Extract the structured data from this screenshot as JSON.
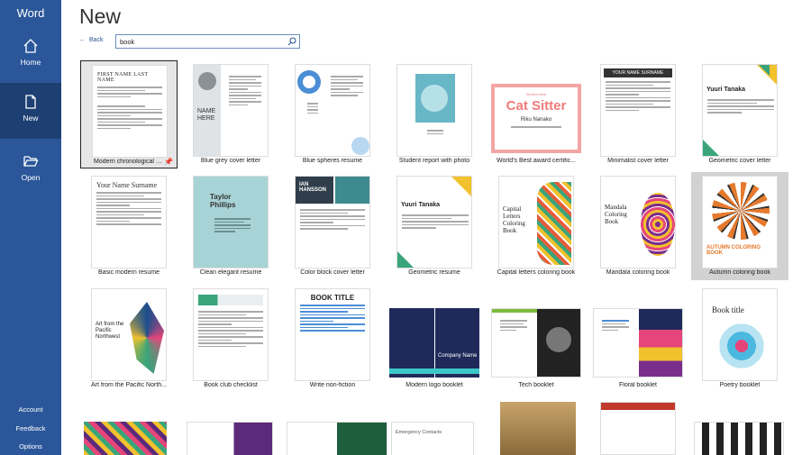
{
  "app": {
    "name": "Word"
  },
  "sidebar": {
    "items": [
      {
        "label": "Home",
        "icon": "home-icon"
      },
      {
        "label": "New",
        "icon": "new-document-icon"
      },
      {
        "label": "Open",
        "icon": "folder-icon"
      }
    ],
    "bottom": [
      {
        "label": "Account"
      },
      {
        "label": "Feedback"
      },
      {
        "label": "Options"
      }
    ]
  },
  "page": {
    "title": "New",
    "back_label": "Back"
  },
  "search": {
    "value": "book",
    "icon": "search-icon"
  },
  "templates": [
    {
      "caption": "Modern chronological cov..."
    },
    {
      "caption": "Blue grey cover letter"
    },
    {
      "caption": "Blue spheres resume"
    },
    {
      "caption": "Student report with photo"
    },
    {
      "caption": "World's Best award certific..."
    },
    {
      "caption": "Minimalist cover letter"
    },
    {
      "caption": "Geometric cover letter"
    },
    {
      "caption": "Basic modern resume"
    },
    {
      "caption": "Clean elegant resume"
    },
    {
      "caption": "Color block cover letter"
    },
    {
      "caption": "Geometric resume"
    },
    {
      "caption": "Capital letters coloring book"
    },
    {
      "caption": "Mandala coloring book"
    },
    {
      "caption": "Autumn coloring book"
    },
    {
      "caption": "Art from the Pacific North..."
    },
    {
      "caption": "Book club checklist"
    },
    {
      "caption": "Write non-fiction"
    },
    {
      "caption": "Modern logo booklet"
    },
    {
      "caption": "Tech booklet"
    },
    {
      "caption": "Floral booklet"
    },
    {
      "caption": "Poetry booklet"
    }
  ],
  "thumb_text": {
    "t0_name": "FIRST NAME LAST NAME",
    "t1_name": "NAME HERE",
    "t4_small": "World's Best",
    "t4_title": "Cat Sitter",
    "t4_name": "Riku Nanako",
    "t5_name": "YOUR NAME SURNAME",
    "t6_name": "Yuuri Tanaka",
    "t7_name": "Your Name Surname",
    "t8_name": "Taylor Phillips",
    "t9_name": "IAN HANSSON",
    "t10_name": "Yuuri Tanaka",
    "t11_title": "Capital Letters Coloring Book",
    "t12_title": "Mandala Coloring Book",
    "t13_title": "AUTUMN COLORING BOOK",
    "t14_title": "Art from the Pacific Northwest",
    "t16_title": "BOOK TITLE",
    "t17_company": "Company Name",
    "t20_title": "Book title",
    "p3_text": "Emergency Contacts"
  },
  "colors": {
    "sidebar": "#2b579a",
    "sidebar_active": "#1d3f72",
    "cat_sitter": "#f07a7a"
  }
}
